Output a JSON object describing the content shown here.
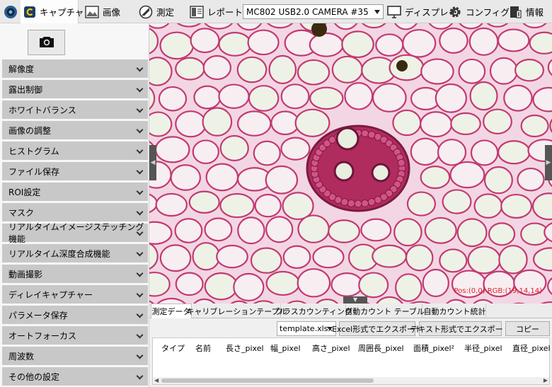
{
  "toolbar": {
    "items": [
      {
        "label": "キャプチャ",
        "icon": "capture-icon"
      },
      {
        "label": "画像",
        "icon": "image-icon"
      },
      {
        "label": "測定",
        "icon": "measure-icon"
      },
      {
        "label": "レポート",
        "icon": "report-icon"
      },
      {
        "label": "ディスプレイ",
        "icon": "display-icon"
      },
      {
        "label": "コンフィグ",
        "icon": "gear-icon"
      },
      {
        "label": "情報",
        "icon": "info-icon"
      }
    ],
    "camera": "MC802 USB2.0 CAMERA #35"
  },
  "sidebar": {
    "sections": [
      "解像度",
      "露出制御",
      "ホワイトバランス",
      "画像の調整",
      "ヒストグラム",
      "ファイル保存",
      "ROI設定",
      "マスク",
      "リアルタイムイメージステッチング機能",
      "リアルタイム深度合成機能",
      "動画撮影",
      "ディレイキャプチャー",
      "パラメータ保存",
      "オートフォーカス",
      "周波数",
      "その他の設定"
    ]
  },
  "viewer": {
    "pos_readout": "Pos:(0,0) RGB:(19,14,14)"
  },
  "tabs": [
    "測定データ",
    "キャリブレーションテーブル",
    "クラスカウンティング",
    "自動カウント テーブル",
    "自動カウント統計"
  ],
  "export": {
    "template": "template.xlsx",
    "excel_export": "Excel形式でエクスポート",
    "text_export": "テキスト形式でエクスポート",
    "copy": "コピー"
  },
  "table": {
    "columns": [
      "タイプ",
      "名前",
      "長さ_pixel",
      "幅_pixel",
      "高さ_pixel",
      "周囲長_pixel",
      "面積_pixel²",
      "半径_pixel",
      "直径_pixel"
    ]
  }
}
